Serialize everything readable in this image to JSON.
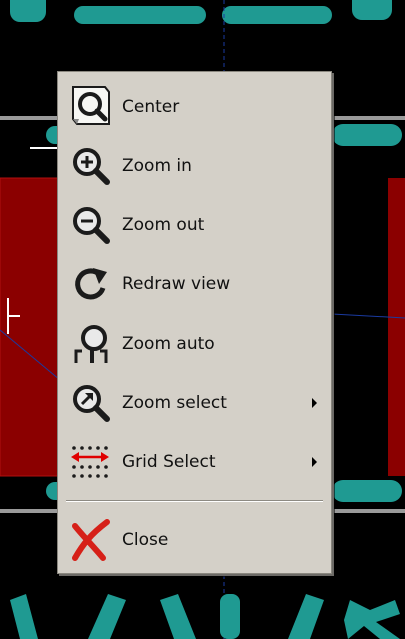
{
  "menu": {
    "items": [
      {
        "label": "Center",
        "icon": "center-icon",
        "submenu": false
      },
      {
        "label": "Zoom in",
        "icon": "zoom-in-icon",
        "submenu": false
      },
      {
        "label": "Zoom out",
        "icon": "zoom-out-icon",
        "submenu": false
      },
      {
        "label": "Redraw view",
        "icon": "redraw-icon",
        "submenu": false
      },
      {
        "label": "Zoom auto",
        "icon": "zoom-auto-icon",
        "submenu": false
      },
      {
        "label": "Zoom select",
        "icon": "zoom-select-icon",
        "submenu": true
      },
      {
        "label": "Grid Select",
        "icon": "grid-select-icon",
        "submenu": true
      },
      {
        "label": "Close",
        "icon": "close-icon",
        "submenu": false
      }
    ]
  },
  "colors": {
    "board_background": "#000000",
    "pad_copper": "#1f9a92",
    "track_red": "#8b0000",
    "edge_gray": "#9a9a9a",
    "menu_face": "#d4d0c8"
  }
}
